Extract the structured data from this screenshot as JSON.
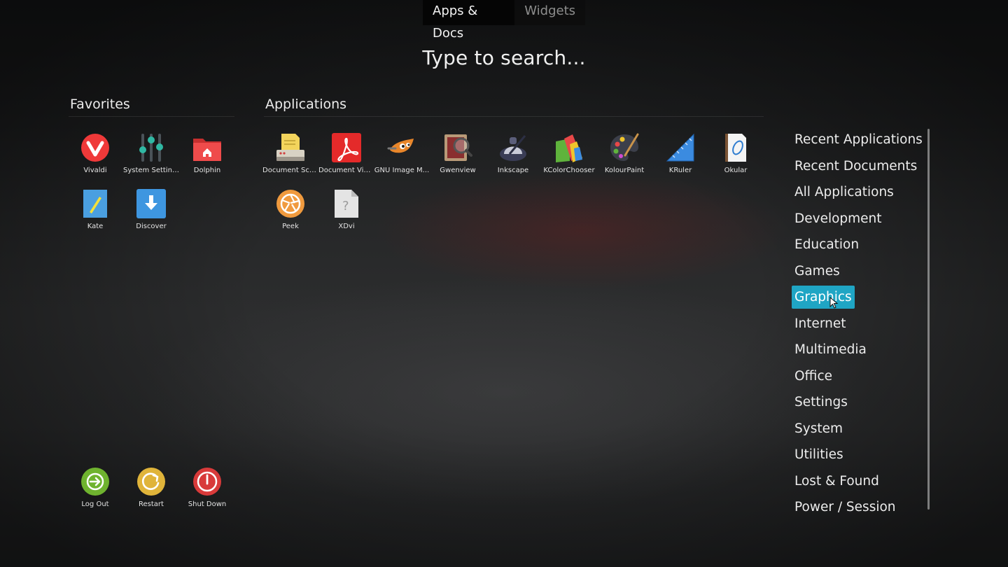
{
  "tabs": {
    "apps_docs": "Apps & Docs",
    "widgets": "Widgets"
  },
  "search": {
    "placeholder": "Type to search..."
  },
  "favorites": {
    "title": "Favorites",
    "items": [
      {
        "label": "Vivaldi",
        "icon": "vivaldi-icon"
      },
      {
        "label": "System Settings",
        "icon": "system-settings-icon"
      },
      {
        "label": "Dolphin",
        "icon": "dolphin-icon"
      },
      {
        "label": "Kate",
        "icon": "kate-icon"
      },
      {
        "label": "Discover",
        "icon": "discover-icon"
      }
    ]
  },
  "applications": {
    "title": "Applications",
    "items": [
      {
        "label": "Document Sca...",
        "icon": "document-scanner-icon"
      },
      {
        "label": "Document Vie...",
        "icon": "document-viewer-icon"
      },
      {
        "label": "GNU Image M...",
        "icon": "gimp-icon"
      },
      {
        "label": "Gwenview",
        "icon": "gwenview-icon"
      },
      {
        "label": "Inkscape",
        "icon": "inkscape-icon"
      },
      {
        "label": "KColorChooser",
        "icon": "kcolorchooser-icon"
      },
      {
        "label": "KolourPaint",
        "icon": "kolourpaint-icon"
      },
      {
        "label": "KRuler",
        "icon": "kruler-icon"
      },
      {
        "label": "Okular",
        "icon": "okular-icon"
      },
      {
        "label": "Peek",
        "icon": "peek-icon"
      },
      {
        "label": "XDvi",
        "icon": "xdvi-icon"
      }
    ]
  },
  "session": {
    "items": [
      {
        "label": "Log Out",
        "icon": "logout-icon"
      },
      {
        "label": "Restart",
        "icon": "restart-icon"
      },
      {
        "label": "Shut Down",
        "icon": "shutdown-icon"
      }
    ]
  },
  "categories": {
    "items": [
      "Recent Applications",
      "Recent Documents",
      "All Applications",
      "Development",
      "Education",
      "Games",
      "Graphics",
      "Internet",
      "Multimedia",
      "Office",
      "Settings",
      "System",
      "Utilities",
      "Lost & Found",
      "Power / Session"
    ],
    "selected": "Graphics"
  },
  "colors": {
    "accent": "#1fa5c4"
  }
}
